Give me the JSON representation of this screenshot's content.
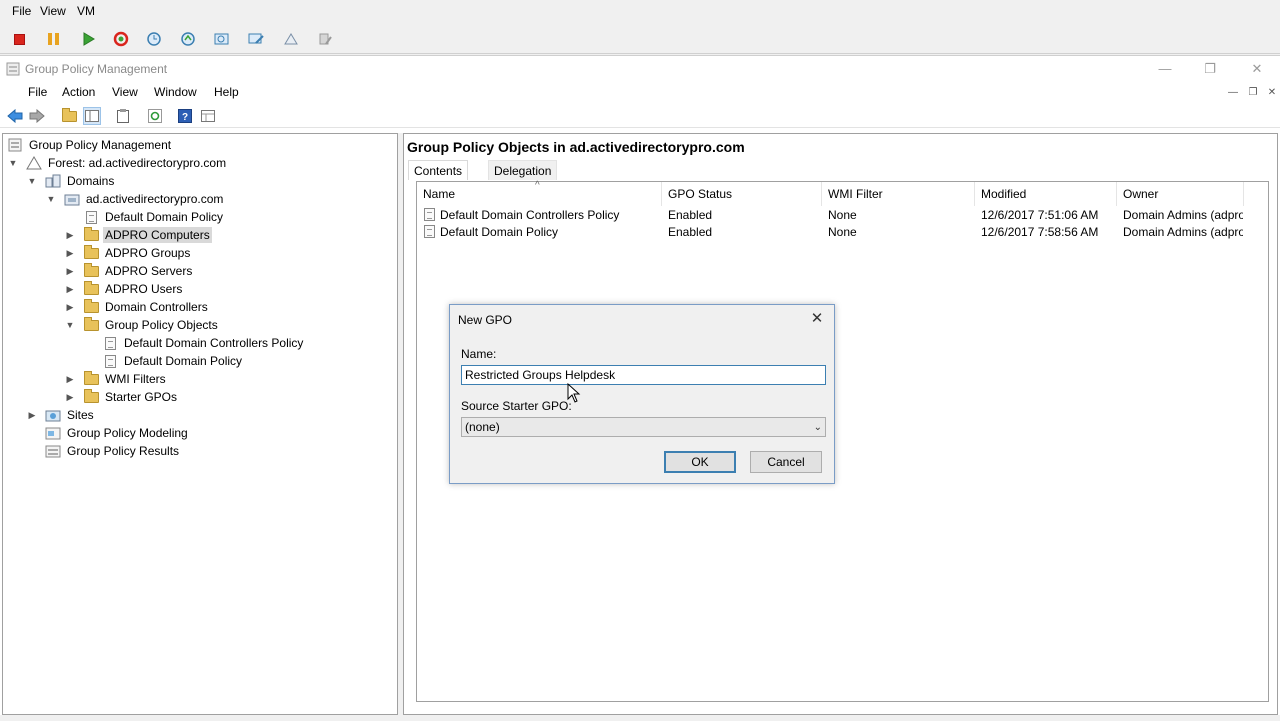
{
  "vm": {
    "menu": [
      "File",
      "View",
      "VM"
    ],
    "toolbar_icons": [
      "stop-icon",
      "pause-icon",
      "play-icon",
      "reset-icon",
      "snapshot-icon",
      "revert-icon",
      "manage-snapshots-icon",
      "enhanced-session-icon",
      "share-icon",
      "settings-icon"
    ]
  },
  "window": {
    "title": "Group Policy Management",
    "controls": {
      "minimize": "—",
      "restore": "❐",
      "close": "✕"
    }
  },
  "menubar": {
    "items": [
      "File",
      "Action",
      "View",
      "Window",
      "Help"
    ],
    "mdi_controls": {
      "minimize": "—",
      "restore": "❐",
      "close": "✕"
    }
  },
  "toolbar_icons": [
    "back-icon",
    "forward-icon",
    "up-folder-icon",
    "show-hide-tree-icon",
    "properties-icon",
    "refresh-icon",
    "help-icon",
    "export-list-icon"
  ],
  "tree": {
    "root": "Group Policy Management",
    "forest": "Forest: ad.activedirectorypro.com",
    "domains": "Domains",
    "domain": "ad.activedirectorypro.com",
    "items": [
      "Default Domain Policy",
      "ADPRO Computers",
      "ADPRO Groups",
      "ADPRO Servers",
      "ADPRO Users",
      "Domain Controllers",
      "Group Policy Objects",
      "Default Domain Controllers Policy",
      "Default Domain Policy",
      "WMI Filters",
      "Starter GPOs"
    ],
    "sites": "Sites",
    "modeling": "Group Policy Modeling",
    "results": "Group Policy Results"
  },
  "right": {
    "title": "Group Policy Objects in ad.activedirectorypro.com",
    "tabs": [
      "Contents",
      "Delegation"
    ],
    "columns": [
      "Name",
      "GPO Status",
      "WMI Filter",
      "Modified",
      "Owner"
    ],
    "rows": [
      {
        "name": "Default Domain Controllers Policy",
        "status": "Enabled",
        "wmi": "None",
        "modified": "12/6/2017 7:51:06 AM",
        "owner": "Domain Admins (adpro..."
      },
      {
        "name": "Default Domain Policy",
        "status": "Enabled",
        "wmi": "None",
        "modified": "12/6/2017 7:58:56 AM",
        "owner": "Domain Admins (adpro..."
      }
    ]
  },
  "dialog": {
    "title": "New GPO",
    "close": "✕",
    "name_label": "Name:",
    "name_value": "Restricted Groups Helpdesk",
    "source_label": "Source Starter GPO:",
    "source_value": "(none)",
    "ok": "OK",
    "cancel": "Cancel"
  }
}
